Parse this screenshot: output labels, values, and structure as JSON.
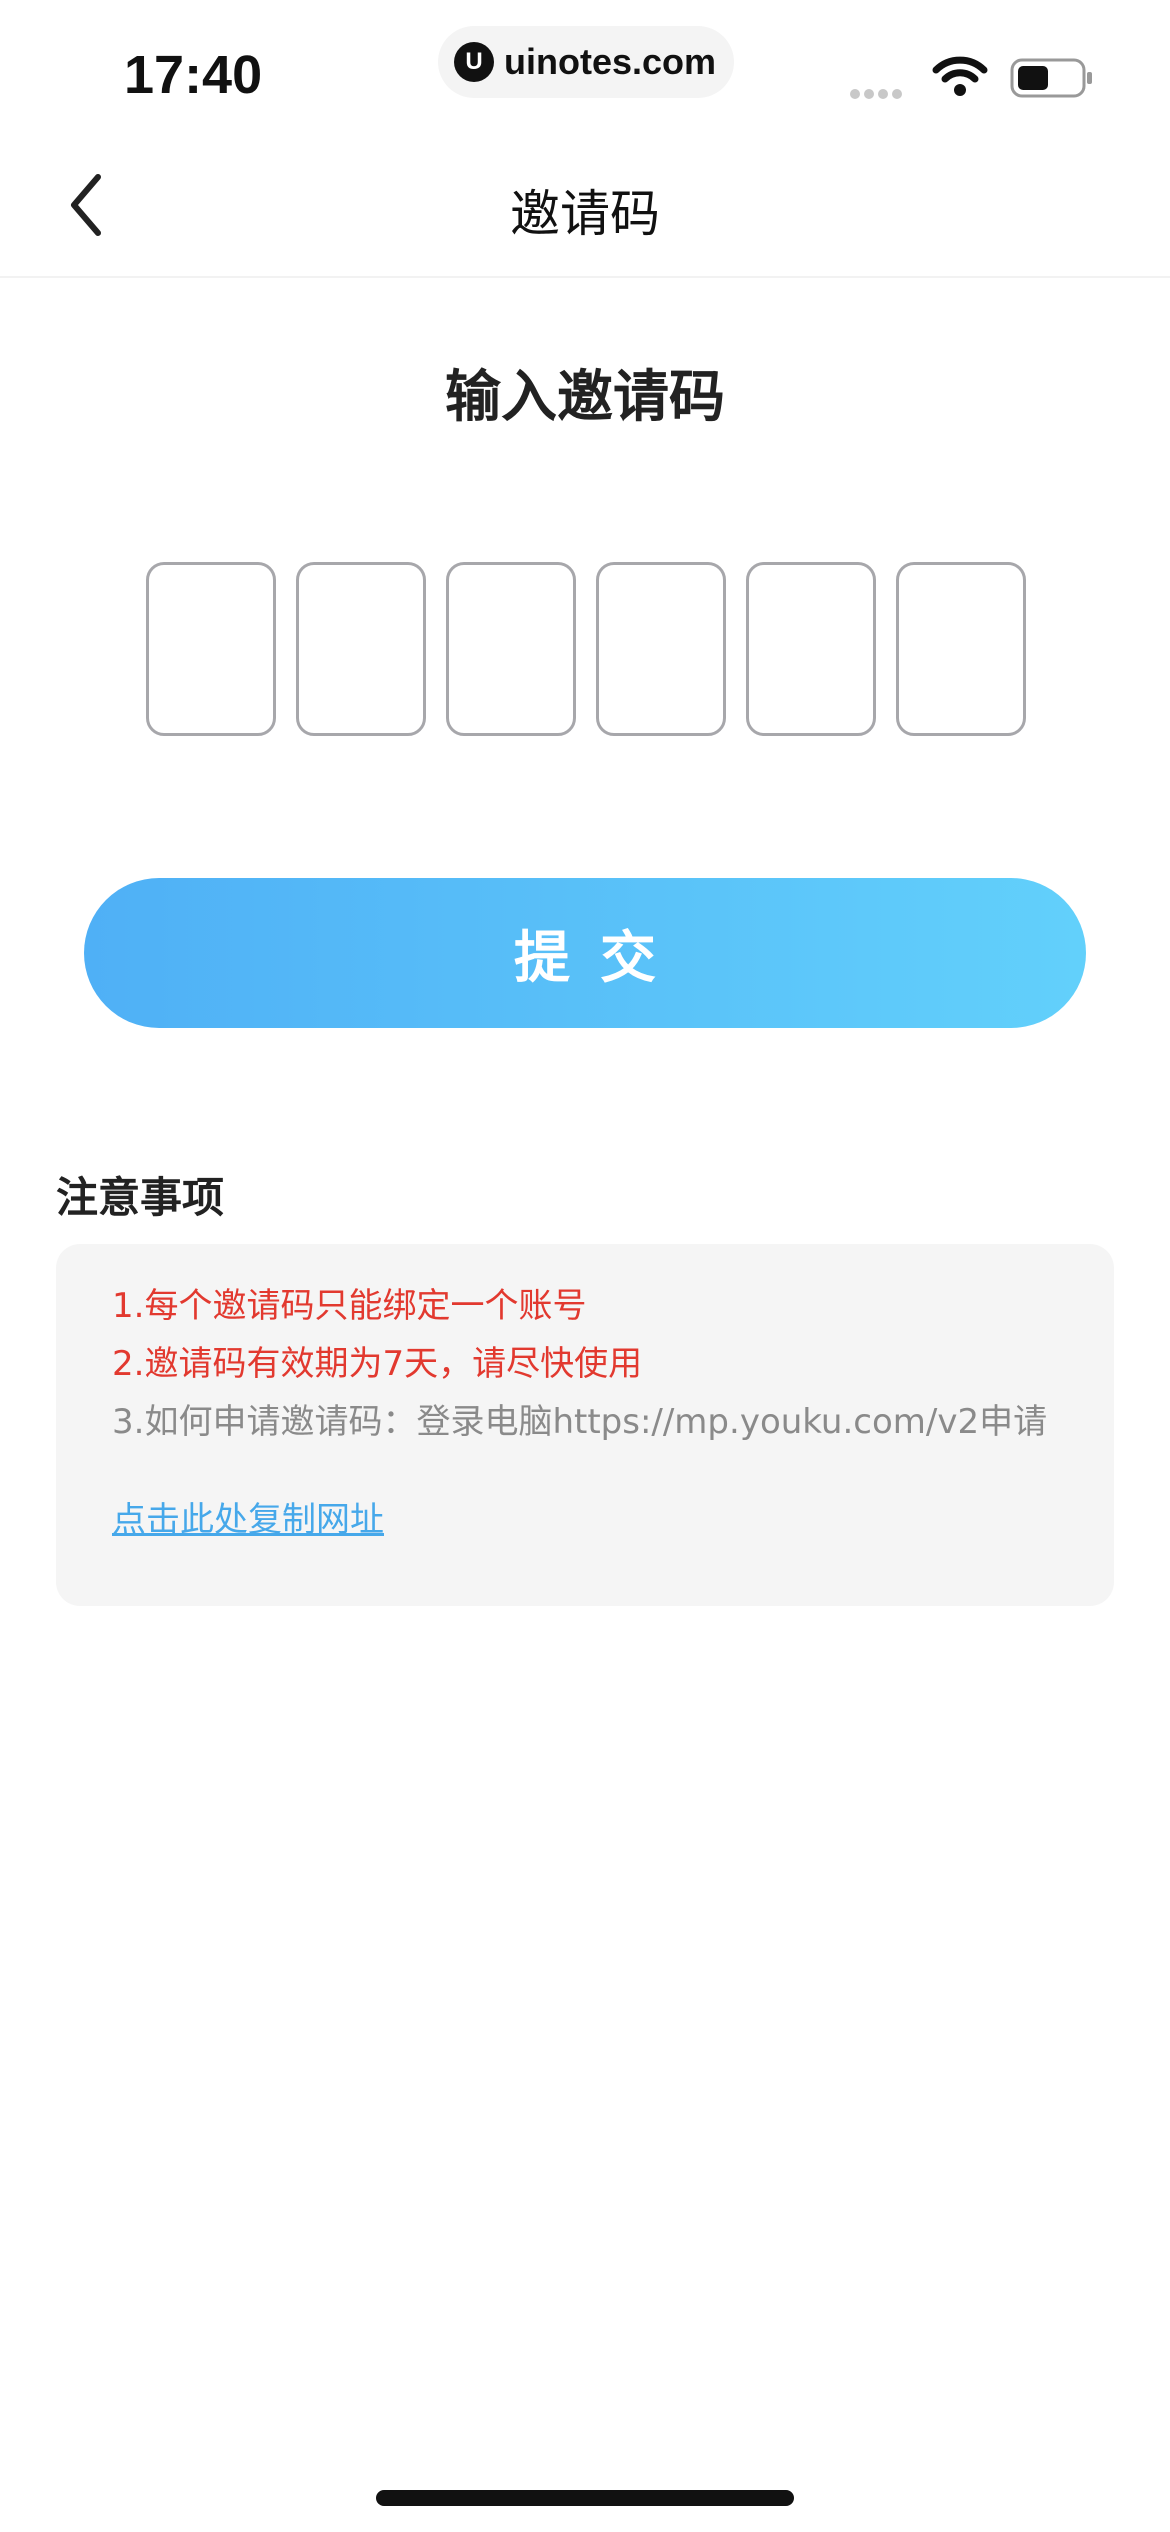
{
  "status_bar": {
    "time": "17:40",
    "url": "uinotes.com",
    "url_logo_glyph": "U",
    "icons": [
      "signal-icon",
      "wifi-icon",
      "battery-icon"
    ]
  },
  "nav": {
    "title": "邀请码",
    "back_icon": "chevron-left-icon"
  },
  "main": {
    "heading": "输入邀请码",
    "code_boxes": [
      "",
      "",
      "",
      "",
      "",
      ""
    ],
    "submit_label": "提交"
  },
  "notes": {
    "title": "注意事项",
    "items": [
      "1.每个邀请码只能绑定一个账号",
      "2.邀请码有效期为7天，请尽快使用",
      "3.如何申请邀请码：登录电脑https://mp.youku.com/v2申请"
    ],
    "copy_link": "点击此处复制网址"
  },
  "colors": {
    "accent_gradient_start": "#4fb0f6",
    "accent_gradient_end": "#62d0fb",
    "note_red": "#e2392f",
    "note_gray": "#8a8a8a",
    "link_blue": "#46a8ea"
  }
}
